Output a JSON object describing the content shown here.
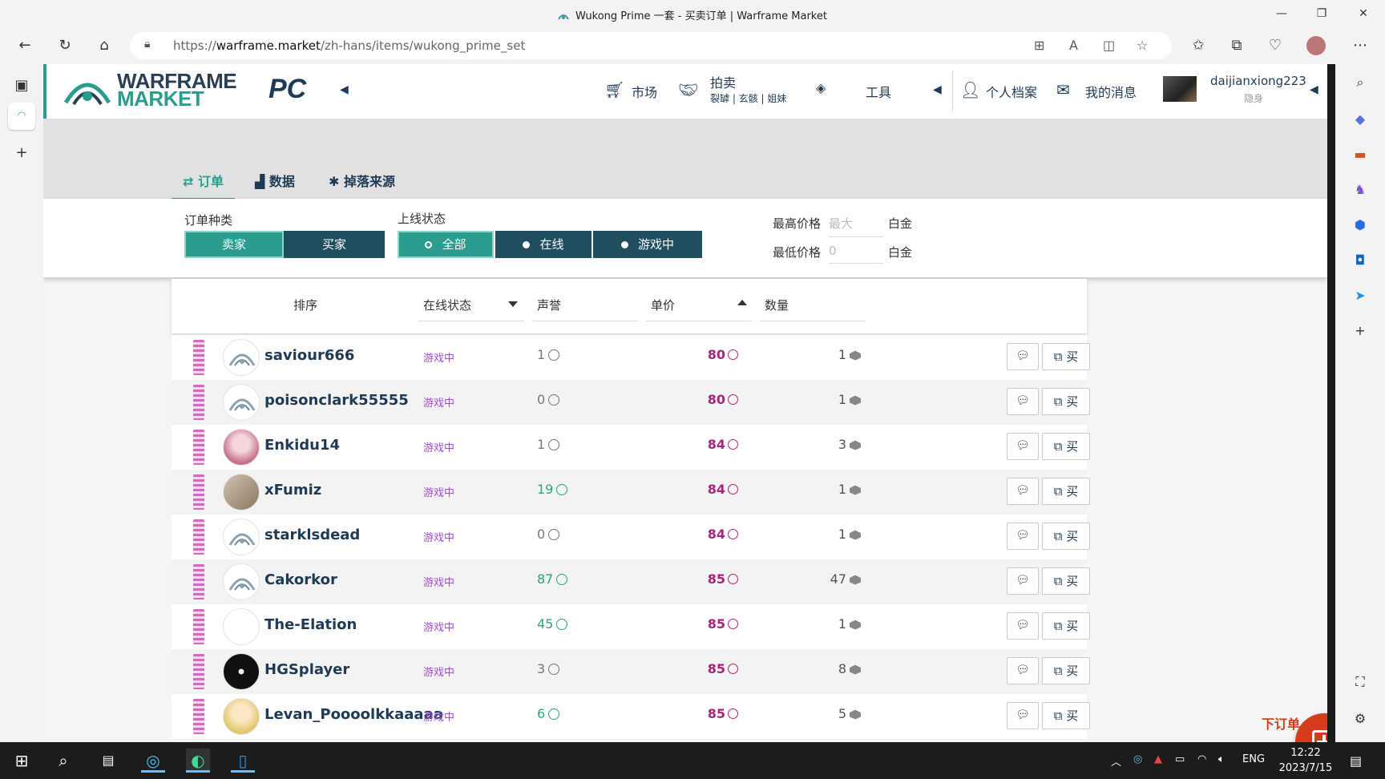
{
  "window": {
    "title": "Wukong Prime 一套 - 买卖订单 | Warframe Market",
    "minimize": "—",
    "restore": "❐",
    "close": "✕"
  },
  "browser": {
    "url_prefix": "https://",
    "url_domain": "warframe.market",
    "url_path": "/zh-hans/items/wukong_prime_set"
  },
  "header": {
    "logo_line1": "WARFRAME",
    "logo_line2": "MARKET",
    "platform": "PC",
    "nav": {
      "market": "市场",
      "auction": "拍卖",
      "auction_sub": "裂罅 | 玄骸 | 姐妹",
      "tools": "工具",
      "profile": "个人档案",
      "messages": "我的消息"
    },
    "username": "daijianxiong223",
    "user_status": "隐身"
  },
  "tabs": [
    {
      "icon": "⇄",
      "label": "订单"
    },
    {
      "icon": "▟",
      "label": "数据"
    },
    {
      "icon": "✱",
      "label": "掉落来源"
    }
  ],
  "filters": {
    "order_type_label": "订单种类",
    "seller": "卖家",
    "buyer": "买家",
    "online_label": "上线状态",
    "all": "全部",
    "online": "在线",
    "ingame": "游戏中",
    "max_price_label": "最高价格",
    "max_price_placeholder": "最大",
    "min_price_label": "最低价格",
    "min_price_placeholder": "0",
    "currency": "白金"
  },
  "table": {
    "headers": {
      "sort": "排序",
      "status": "在线状态",
      "reputation": "声誉",
      "price": "单价",
      "quantity": "数量"
    },
    "buy_label": "买",
    "rows": [
      {
        "user": "saviour666",
        "status": "游戏中",
        "rep": "1",
        "price": "80",
        "qty": "1",
        "avatar": "default"
      },
      {
        "user": "poisonclark55555",
        "status": "游戏中",
        "rep": "0",
        "price": "80",
        "qty": "1",
        "avatar": "default"
      },
      {
        "user": "Enkidu14",
        "status": "游戏中",
        "rep": "1",
        "price": "84",
        "qty": "3",
        "avatar": "pink"
      },
      {
        "user": "xFumiz",
        "status": "游戏中",
        "rep": "19",
        "price": "84",
        "qty": "1",
        "avatar": "photo"
      },
      {
        "user": "starklsdead",
        "status": "游戏中",
        "rep": "0",
        "price": "84",
        "qty": "1",
        "avatar": "default"
      },
      {
        "user": "Cakorkor",
        "status": "游戏中",
        "rep": "87",
        "price": "85",
        "qty": "47",
        "avatar": "default"
      },
      {
        "user": "The-Elation",
        "status": "游戏中",
        "rep": "45",
        "price": "85",
        "qty": "1",
        "avatar": "sketch"
      },
      {
        "user": "HGSplayer",
        "status": "游戏中",
        "rep": "3",
        "price": "85",
        "qty": "8",
        "avatar": "dark"
      },
      {
        "user": "Levan_Poooolkkaaaaa",
        "status": "游戏中",
        "rep": "6",
        "price": "85",
        "qty": "5",
        "avatar": "anime"
      }
    ]
  },
  "fab_label": "下订单",
  "taskbar": {
    "lang": "ENG",
    "time": "12:22",
    "date": "2023/7/15"
  }
}
